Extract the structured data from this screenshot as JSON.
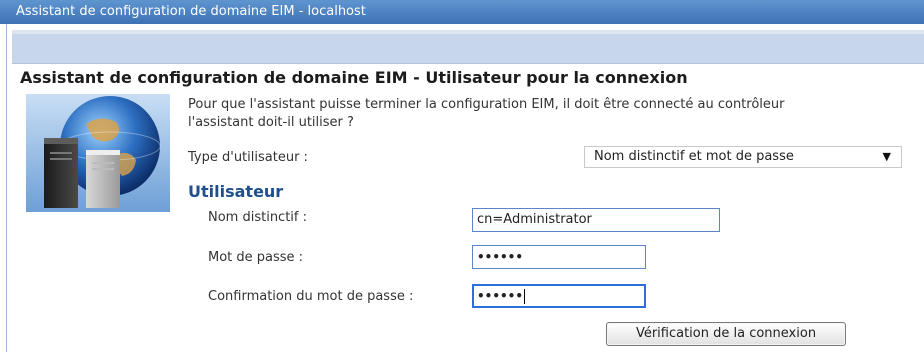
{
  "window": {
    "title": "Assistant de configuration de domaine EIM - localhost"
  },
  "page": {
    "title": "Assistant de configuration de domaine EIM - Utilisateur pour la connexion"
  },
  "intro": {
    "line1": "Pour que l'assistant puisse terminer la configuration EIM, il doit être connecté au contrôleur",
    "line2": "l'assistant doit-il utiliser ?"
  },
  "user_type": {
    "label": "Type d'utilisateur :",
    "selected": "Nom distinctif et mot de passe"
  },
  "user_section": {
    "title": "Utilisateur",
    "dn_label": "Nom distinctif :",
    "dn_value": "cn=Administrator",
    "password_label": "Mot de passe :",
    "password_value": "••••••",
    "confirm_label": "Confirmation du mot de passe :",
    "confirm_value": "••••••"
  },
  "actions": {
    "verify_label": "Vérification de la connexion"
  },
  "icons": {
    "illustration": "globe-server-icon",
    "dropdown": "chevron-down-icon"
  }
}
